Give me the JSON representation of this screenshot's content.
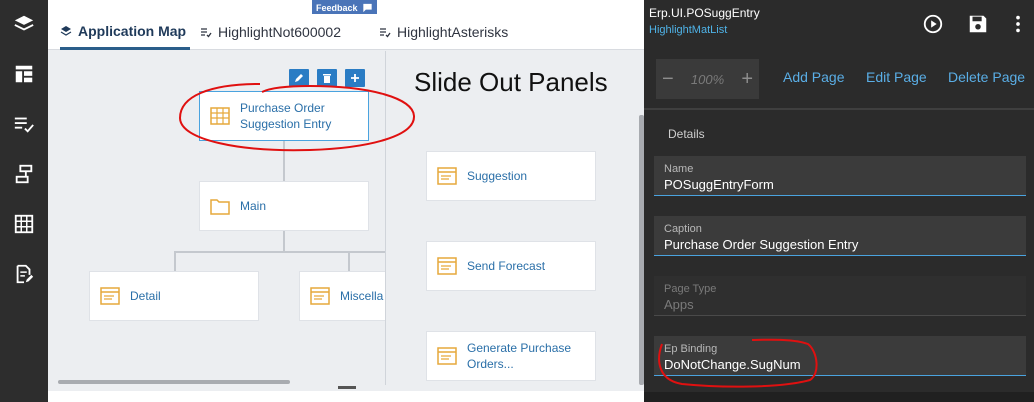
{
  "main": {
    "feedback_label": "Feedback",
    "tabs": [
      {
        "label": "Application Map",
        "active": true
      },
      {
        "label": "HighlightNot600002",
        "active": false
      },
      {
        "label": "HighlightAsterisks",
        "active": false
      }
    ],
    "slide_title": "Slide Out Panels",
    "map_cards": {
      "root": {
        "line1": "Purchase Order",
        "line2": "Suggestion Entry"
      },
      "main": "Main",
      "detail": "Detail",
      "misc": "Miscella"
    },
    "slide_cards": [
      "Suggestion",
      "Send Forecast",
      "Generate Purchase Orders..."
    ]
  },
  "panel": {
    "title": "Erp.UI.POSuggEntry",
    "subtitle": "HighlightMatList",
    "zoom": "100%",
    "links": {
      "add": "Add Page",
      "edit": "Edit Page",
      "delete": "Delete Page"
    },
    "details_label": "Details",
    "fields": [
      {
        "label": "Name",
        "value": "POSuggEntryForm",
        "disabled": false
      },
      {
        "label": "Caption",
        "value": "Purchase Order Suggestion Entry",
        "disabled": false
      },
      {
        "label": "Page Type",
        "value": "Apps",
        "disabled": true
      },
      {
        "label": "Ep Binding",
        "value": "DoNotChange.SugNum",
        "disabled": false
      }
    ]
  },
  "colors": {
    "accent": "#2a7cc4",
    "link": "#5aaee6",
    "annotation": "#e01010",
    "card_icon": "#e6a93c"
  },
  "icons": [
    "layers-icon",
    "layout-icon",
    "checklist-icon",
    "flow-icon",
    "grid-icon",
    "edit-document-icon",
    "play-icon",
    "save-icon",
    "more-vertical-icon",
    "pencil-icon",
    "trash-icon",
    "plus-icon"
  ]
}
